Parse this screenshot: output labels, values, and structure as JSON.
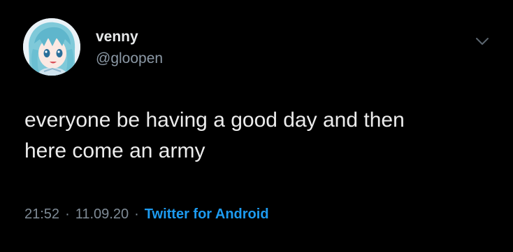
{
  "tweet": {
    "author": {
      "display_name": "venny",
      "handle": "@gloopen",
      "avatar_icon": "anime-avatar-icon"
    },
    "menu_icon": "chevron-down-icon",
    "text": "everyone be having a good day and then\nhere come an army",
    "meta": {
      "time": "21:52",
      "separator": "·",
      "date": "11.09.20",
      "source": "Twitter for Android"
    }
  },
  "colors": {
    "background": "#000000",
    "primary_text": "#e7e9ea",
    "secondary_text": "#8b98a5",
    "link": "#1d9bf0"
  }
}
